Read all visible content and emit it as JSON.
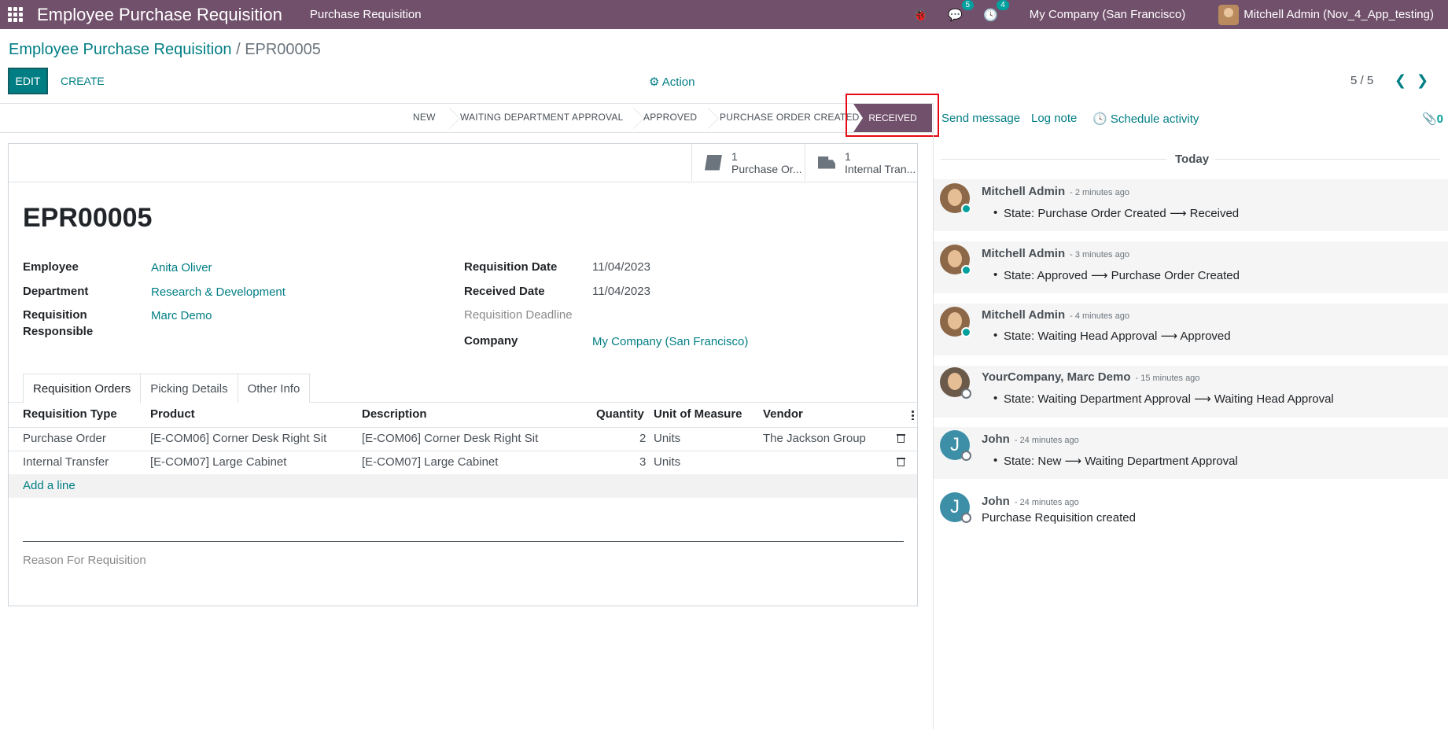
{
  "navbar": {
    "app_title": "Employee Purchase Requisition",
    "menu": "Purchase Requisition",
    "chat_badge": "5",
    "activity_badge": "4",
    "company": "My Company (San Francisco)",
    "user": "Mitchell Admin (Nov_4_App_testing)",
    "bug_icon": "🐞",
    "chat_icon": "💬",
    "clock_icon": "🕓"
  },
  "breadcrumb": {
    "parent": "Employee Purchase Requisition",
    "separator": "/",
    "current": "EPR00005"
  },
  "control": {
    "edit": "EDIT",
    "create": "CREATE",
    "action": "⚙ Action",
    "pager": "5 / 5",
    "prev": "❮",
    "next": "❯"
  },
  "stages": [
    "NEW",
    "WAITING DEPARTMENT APPROVAL",
    "APPROVED",
    "PURCHASE ORDER CREATED",
    "RECEIVED"
  ],
  "active_stage": "RECEIVED",
  "smart_buttons": [
    {
      "count": "1",
      "label": "Purchase Or..."
    },
    {
      "count": "1",
      "label": "Internal Tran..."
    }
  ],
  "record": {
    "name": "EPR00005",
    "employee_label": "Employee",
    "employee": "Anita Oliver",
    "department_label": "Department",
    "department": "Research & Development",
    "responsible_label_1": "Requisition",
    "responsible_label_2": "Responsible",
    "responsible": "Marc Demo",
    "req_date_label": "Requisition Date",
    "req_date": "11/04/2023",
    "recv_date_label": "Received Date",
    "recv_date": "11/04/2023",
    "deadline_label": "Requisition Deadline",
    "company_label": "Company",
    "company": "My Company (San Francisco)"
  },
  "tabs": [
    "Requisition Orders",
    "Picking Details",
    "Other Info"
  ],
  "table": {
    "headers": [
      "Requisition Type",
      "Product",
      "Description",
      "Quantity",
      "Unit of Measure",
      "Vendor"
    ],
    "rows": [
      [
        "Purchase Order",
        "[E-COM06] Corner Desk Right Sit",
        "[E-COM06] Corner Desk Right Sit",
        "2",
        "Units",
        "The Jackson Group"
      ],
      [
        "Internal Transfer",
        "[E-COM07] Large Cabinet",
        "[E-COM07] Large Cabinet",
        "3",
        "Units",
        ""
      ]
    ],
    "add_line": "Add a line"
  },
  "reason_label": "Reason For Requisition",
  "chatter": {
    "send_message": "Send message",
    "log_note": "Log note",
    "schedule_activity": "🕓 Schedule activity",
    "attachments": "📎0",
    "today": "Today",
    "messages": [
      {
        "author": "Mitchell Admin",
        "time": "- 2 minutes ago",
        "body": "State: Purchase Order Created ⟶ Received"
      },
      {
        "author": "Mitchell Admin",
        "time": "- 3 minutes ago",
        "body": "State: Approved ⟶ Purchase Order Created"
      },
      {
        "author": "Mitchell Admin",
        "time": "- 4 minutes ago",
        "body": "State: Waiting Head Approval ⟶ Approved"
      },
      {
        "author": "YourCompany, Marc Demo",
        "time": "- 15 minutes ago",
        "body": "State: Waiting Department Approval ⟶ Waiting Head Approval"
      },
      {
        "author": "John",
        "time": "- 24 minutes ago",
        "body": "State: New ⟶ Waiting Department Approval",
        "initial": "J"
      },
      {
        "author": "John",
        "time": "- 24 minutes ago",
        "body": "Purchase Requisition created",
        "initial": "J"
      }
    ]
  }
}
